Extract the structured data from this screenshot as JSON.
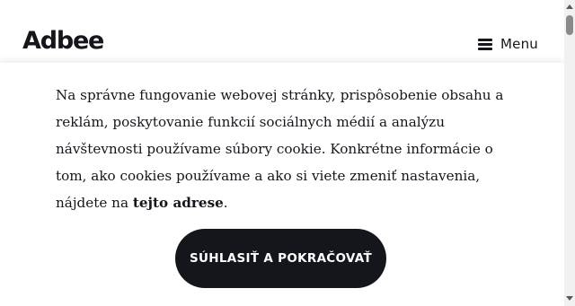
{
  "header": {
    "logo": "Adbee",
    "menu_label": "Menu",
    "menu_icon": "hamburger-icon"
  },
  "cookie_banner": {
    "text_before_link": "Na správne fungovanie webovej stránky, prispôsobenie obsahu a reklám, poskytovanie funkcií sociálnych médií a analýzu návštevnosti používame súbory cookie. Konkrétne informácie o tom, ako cookies používame a ako si viete zmeniť nastavenia, nájdete na ",
    "link_text": "tejto adrese",
    "text_after_link": ".",
    "accept_label": "SÚHLASIŤ A POKRAČOVAŤ"
  },
  "colors": {
    "primary": "#15151c",
    "background": "#ffffff"
  }
}
